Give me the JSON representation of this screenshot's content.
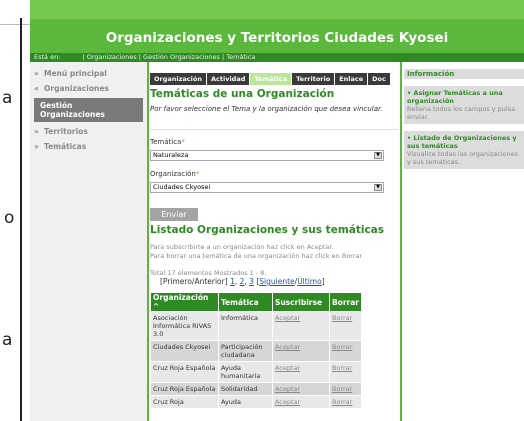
{
  "edge_letters": [
    "a",
    "o",
    "a"
  ],
  "header": {
    "title": "Organizaciones y Territorios Ciudades Kyosei"
  },
  "breadcrumb": {
    "label": "Está en:",
    "path": "| Organizaciones | Gestión Organizaciones | Temática"
  },
  "sidebar": {
    "items": [
      {
        "chevron": "»",
        "label": "Menú principal"
      },
      {
        "chevron": "«",
        "label": "Organizaciones"
      },
      {
        "chevron": "",
        "label": "Gestión Organizaciones"
      },
      {
        "chevron": "»",
        "label": "Territorios"
      },
      {
        "chevron": "»",
        "label": "Temáticas"
      }
    ]
  },
  "tabs": [
    "Organización",
    "Actividad",
    "Temática",
    "Territorio",
    "Enlace",
    "Doc"
  ],
  "form": {
    "title": "Temáticas de una Organización",
    "intro": "Por favor seleccione el Tema y la organización que desea vincular.",
    "tematica_label": "Temática",
    "tematica_value": "Naturaleza",
    "organizacion_label": "Organización",
    "organizacion_value": "Ciudades Ckyosei",
    "required_mark": "*",
    "submit_label": "Enviar"
  },
  "list": {
    "title": "Listado Organizaciones y sus temáticas",
    "help1": "Para subscribirte a un organización haz click en Aceptar.",
    "help2": "Para borrar una temática de una organización haz click en Borrar",
    "total": "Total:17 elementos Mostrados 1 - 8.",
    "pager": {
      "first_prev": "[Primero/Anterior]",
      "p1": "1",
      "p2": "2",
      "p3": "3",
      "open": "[",
      "next": "Siguiente",
      "slash": "/",
      "last": "Último",
      "close": "]"
    },
    "columns": [
      "Organización ^",
      "Temática",
      "Suscribirse",
      "Borrar"
    ],
    "rows": [
      [
        "Asociación Informática RIVAS 3.0",
        "Informática",
        "Aceptar",
        "Borrar"
      ],
      [
        "Ciudades Ckyosei",
        "Participación ciudadana",
        "Aceptar",
        "Borrar"
      ],
      [
        "Cruz Roja Española",
        "Ayuda humanitaria",
        "Aceptar",
        "Borrar"
      ],
      [
        "Cruz Roja Española",
        "Solidaridad",
        "Aceptar",
        "Borrar"
      ],
      [
        "Cruz Roja",
        "Ayuda",
        "Aceptar",
        "Borrar"
      ]
    ]
  },
  "info": {
    "header": "Información",
    "blocks": [
      {
        "title": "• Asignar Temáticas a una organización",
        "desc": "Rellena todos los campos y pulsa enviar."
      },
      {
        "title": "• Listado de Organizaciones y sus temáticas",
        "desc": "Visualice todas las organizaciones y sus temáticas."
      }
    ]
  },
  "colors": {
    "header_green": "#5ab83c",
    "dark_green": "#2e8a23",
    "active_tab": "#b9e79c"
  }
}
